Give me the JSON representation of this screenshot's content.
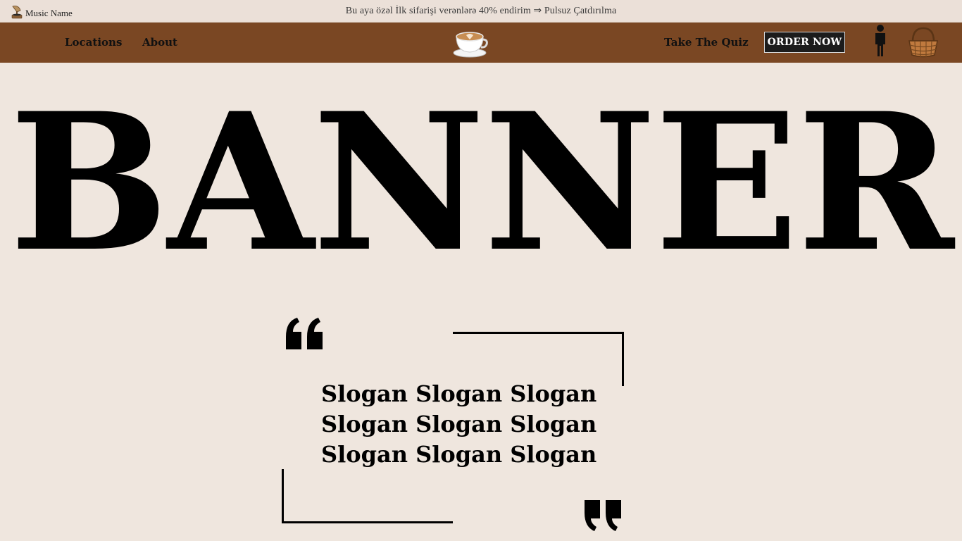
{
  "topbar": {
    "music_label": "Music Name",
    "music_icon": "gramophone-icon",
    "announcement": "Bu aya özəl İlk sifarişi verənlərə 40% endirim ⇒ Pulsuz Çatdırılma"
  },
  "navbar": {
    "links": {
      "locations": "Locations",
      "about": "About",
      "quiz": "Take The Quiz"
    },
    "logo_icon": "coffee-cup-icon",
    "order_button": "ORDER NOW",
    "user_icon": "person-icon",
    "basket_icon": "basket-icon",
    "background_color": "#7a4723"
  },
  "hero": {
    "banner_text": "BANNER",
    "slogan_lines": [
      "Slogan Slogan Slogan",
      "Slogan Slogan Slogan",
      "Slogan Slogan Slogan"
    ]
  },
  "colors": {
    "page_background": "#efe6de",
    "topbar_background": "#ebe0d8",
    "button_background": "#1c1c1c"
  }
}
